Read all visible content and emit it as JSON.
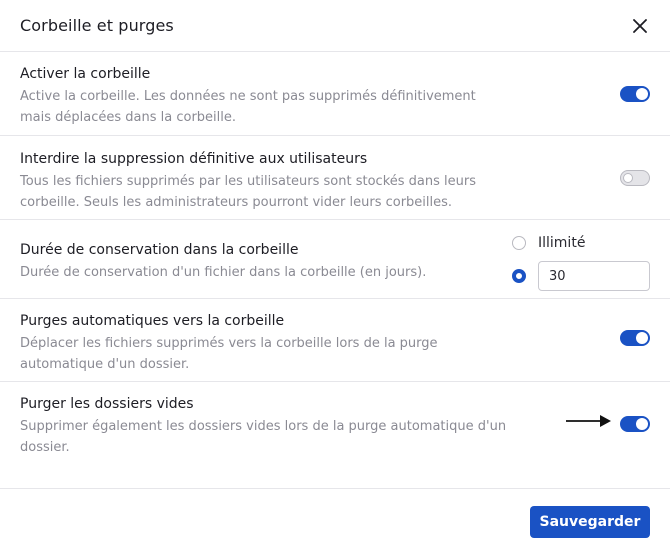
{
  "dialog": {
    "title": "Corbeille et purges",
    "save_label": "Sauvegarder"
  },
  "settings": [
    {
      "title": "Activer la corbeille",
      "description": "Active la corbeille. Les données ne sont pas supprimés définitivement mais déplacées dans la corbeille.",
      "toggle": "on"
    },
    {
      "title": "Interdire la suppression définitive aux utilisateurs",
      "description": "Tous les fichiers supprimés par les utilisateurs sont stockés dans leurs corbeille. Seuls les administrateurs pourront vider leurs corbeilles.",
      "toggle": "off"
    },
    {
      "title": "Durée de conservation dans la corbeille",
      "description": "Durée de conservation d'un fichier dans la corbeille (en jours).",
      "options": [
        {
          "label": "Illimité",
          "selected": false
        },
        {
          "value": "30",
          "selected": true
        }
      ]
    },
    {
      "title": "Purges automatiques vers la corbeille",
      "description": "Déplacer les fichiers supprimés vers la corbeille lors de la purge automatique d'un dossier.",
      "toggle": "on"
    },
    {
      "title": "Purger les dossiers vides",
      "description": "Supprimer également les dossiers vides lors de la purge automatique d'un dossier.",
      "toggle": "on"
    }
  ],
  "colors": {
    "accent": "#1a52c4",
    "muted_text": "#8a8a93",
    "divider": "#e6e6ea"
  },
  "icons": {
    "close": "close-icon",
    "arrow": "arrow-right-icon"
  }
}
